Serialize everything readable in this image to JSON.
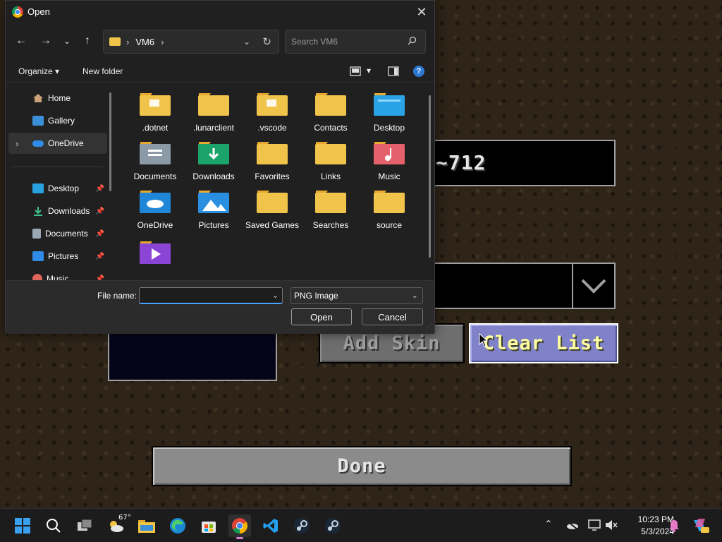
{
  "game": {
    "name_field_text": "~712",
    "add_skin_label": "Add Skin",
    "clear_list_label": "Clear List",
    "done_label": "Done"
  },
  "dialog": {
    "title": "Open",
    "close_glyph": "✕",
    "nav": {
      "back": "←",
      "forward": "→",
      "recent": "⌄",
      "up": "↑"
    },
    "address": {
      "path_separator": "›",
      "folder": "VM6",
      "trailing_separator": "›",
      "dropdown": "⌄",
      "refresh": "↻"
    },
    "search_placeholder": "Search VM6",
    "toolbar": {
      "organize": "Organize",
      "organize_arrow": "▾",
      "new_folder": "New folder",
      "view_arrow": "▾",
      "help": "?"
    },
    "sidebar": [
      {
        "label": "Home",
        "icon": "home-icon",
        "pinned": false
      },
      {
        "label": "Gallery",
        "icon": "gallery-icon",
        "pinned": false
      },
      {
        "label": "OneDrive",
        "icon": "onedrive-icon",
        "pinned": false,
        "expand": "›"
      },
      {
        "label": "Desktop",
        "icon": "desktop-icon",
        "pinned": true
      },
      {
        "label": "Downloads",
        "icon": "downloads-icon",
        "pinned": true
      },
      {
        "label": "Documents",
        "icon": "documents-icon",
        "pinned": true
      },
      {
        "label": "Pictures",
        "icon": "pictures-icon",
        "pinned": true
      },
      {
        "label": "Music",
        "icon": "music-icon",
        "pinned": true
      }
    ],
    "pin_glyph": "📌",
    "files": [
      {
        "name": ".dotnet",
        "icon": "folder-doc-icon"
      },
      {
        "name": ".lunarclient",
        "icon": "folder-icon"
      },
      {
        "name": ".vscode",
        "icon": "folder-doc-icon"
      },
      {
        "name": "Contacts",
        "icon": "folder-icon"
      },
      {
        "name": "Desktop",
        "icon": "desktop-folder-icon"
      },
      {
        "name": "Documents",
        "icon": "documents-folder-icon"
      },
      {
        "name": "Downloads",
        "icon": "downloads-folder-icon"
      },
      {
        "name": "Favorites",
        "icon": "folder-icon"
      },
      {
        "name": "Links",
        "icon": "folder-icon"
      },
      {
        "name": "Music",
        "icon": "music-folder-icon"
      },
      {
        "name": "OneDrive",
        "icon": "onedrive-folder-icon"
      },
      {
        "name": "Pictures",
        "icon": "pictures-folder-icon"
      },
      {
        "name": "Saved Games",
        "icon": "folder-icon"
      },
      {
        "name": "Searches",
        "icon": "folder-icon"
      },
      {
        "name": "source",
        "icon": "folder-icon"
      },
      {
        "name": "",
        "icon": "videos-folder-icon"
      }
    ],
    "file_name_label": "File name:",
    "file_name_value": "",
    "file_type": "PNG Image",
    "open_label": "Open",
    "cancel_label": "Cancel"
  },
  "taskbar": {
    "weather_temp": "67°",
    "time": "10:23 PM",
    "date": "5/3/2024",
    "tray_chevron": "⌃"
  },
  "colors": {
    "folder": "#f0c34a",
    "accent": "#4aa3ff",
    "hover_button": "#7f82c8"
  }
}
